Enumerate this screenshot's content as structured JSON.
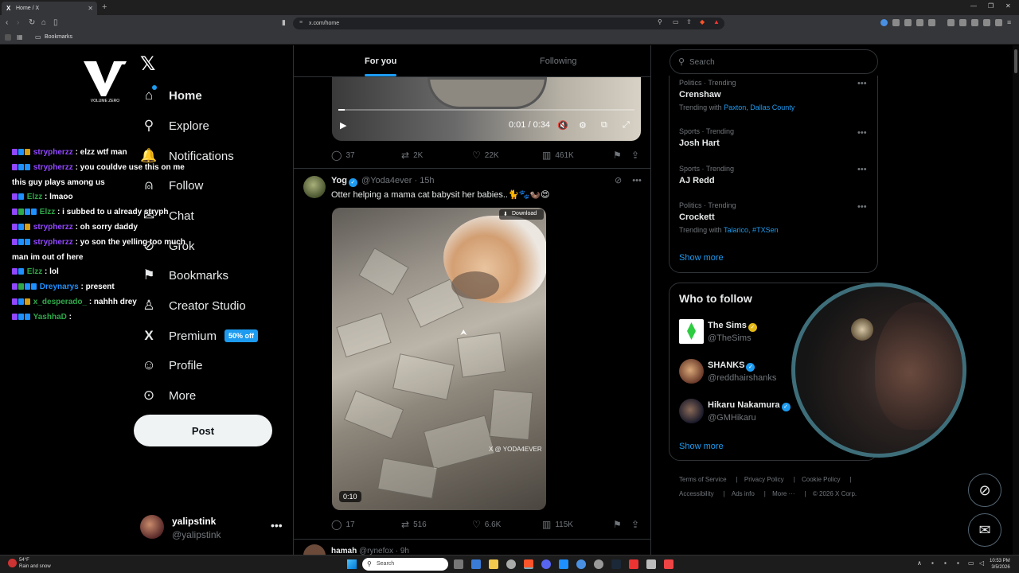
{
  "browser": {
    "tab_title": "Home / X",
    "url": "x.com/home",
    "bookmarks_folder": "Bookmarks",
    "new_tab_symbol": "+"
  },
  "sidebar": {
    "brand_logo_text": "VOLUME ZERO",
    "items": [
      {
        "label": "Home",
        "icon": "home-icon",
        "glyph": "⌂",
        "active": true
      },
      {
        "label": "Explore",
        "icon": "search-icon",
        "glyph": "⚲"
      },
      {
        "label": "Notifications",
        "icon": "bell-icon",
        "glyph": "🔔"
      },
      {
        "label": "Follow",
        "icon": "follow-icon",
        "glyph": "⍝"
      },
      {
        "label": "Chat",
        "icon": "chat-icon",
        "glyph": "✉"
      },
      {
        "label": "Grok",
        "icon": "grok-icon",
        "glyph": "⊘"
      },
      {
        "label": "Bookmarks",
        "icon": "bookmark-icon",
        "glyph": "⚑"
      },
      {
        "label": "Creator Studio",
        "icon": "creator-studio-icon",
        "glyph": "♙"
      },
      {
        "label": "Premium",
        "icon": "x-premium-icon",
        "glyph": "X",
        "badge": "50% off"
      },
      {
        "label": "Profile",
        "icon": "profile-icon",
        "glyph": "☺"
      },
      {
        "label": "More",
        "icon": "more-icon",
        "glyph": "⊙"
      }
    ],
    "post_label": "Post",
    "account": {
      "name": "yalipstink",
      "handle": "@yalipstink"
    }
  },
  "chat": [
    {
      "user": "strypherzz",
      "color": "#9147ff",
      "msg": ": elzz wtf man"
    },
    {
      "user": "strypherzz",
      "color": "#9147ff",
      "msg": ": you couldve use this on me this guy plays among us"
    },
    {
      "user": "Elzz",
      "color": "#2fa84a",
      "msg": ": lmaoo"
    },
    {
      "user": "Elzz",
      "color": "#2fa84a",
      "msg": ": i subbed to u already stryph"
    },
    {
      "user": "strypherzz",
      "color": "#9147ff",
      "msg": ": oh sorry daddy"
    },
    {
      "user": "strypherzz",
      "color": "#9147ff",
      "msg": ": yo son the yelling too much man im out of here"
    },
    {
      "user": "Elzz",
      "color": "#2fa84a",
      "msg": ": lol"
    },
    {
      "user": "Dreynarys",
      "color": "#1e90ff",
      "msg": ": present"
    },
    {
      "user": "x_desperado_",
      "color": "#2fa84a",
      "msg": ": nahhh drey"
    },
    {
      "user": "YashhaD",
      "color": "#2fa84a",
      "msg": ":"
    }
  ],
  "feed": {
    "tabs": [
      "For you",
      "Following"
    ],
    "tweet1": {
      "video_time": "0:01 / 0:34",
      "replies": "37",
      "reposts": "2K",
      "likes": "22K",
      "views": "461K"
    },
    "tweet2": {
      "name": "Yog",
      "handle": "@Yoda4ever",
      "time": "· 15h",
      "text": "Otter helping a mama cat babysit her babies..🐈🐾🦦😍",
      "download_label": "Download",
      "watermark": "X @ YODA4EVER",
      "duration": "0:10",
      "replies": "17",
      "reposts": "516",
      "likes": "6.6K",
      "views": "115K"
    },
    "tweet3": {
      "name": "hamah",
      "handle": "@rynefox",
      "time": "· 9h"
    }
  },
  "right": {
    "search_placeholder": "Search",
    "trends": [
      {
        "context": "Politics · Trending",
        "title": "Crenshaw",
        "with_prefix": "Trending with",
        "with": "Paxton, Dallas County"
      },
      {
        "context": "Sports · Trending",
        "title": "Josh Hart"
      },
      {
        "context": "Sports · Trending",
        "title": "AJ Redd"
      },
      {
        "context": "Politics · Trending",
        "title": "Crockett",
        "with_prefix": "Trending with",
        "with": "Talarico, #TXSen"
      }
    ],
    "show_more": "Show more",
    "who_to_follow": "Who to follow",
    "suggestions": [
      {
        "name": "The Sims",
        "handle": "@TheSims",
        "verified": "gold"
      },
      {
        "name": "SHANKS",
        "handle": "@reddhairshanks",
        "verified": "blue"
      },
      {
        "name": "Hikaru Nakamura",
        "handle": "@GMHikaru",
        "verified": "blue"
      }
    ],
    "show_more_2": "Show more",
    "footer_row1": [
      "Terms of Service",
      "Privacy Policy",
      "Cookie Policy"
    ],
    "footer_row2": [
      "Accessibility",
      "Ads info",
      "More ···",
      "© 2026 X Corp."
    ]
  },
  "taskbar": {
    "weather_temp": "54°F",
    "weather_desc": "Rain and snow",
    "search_placeholder": "Search",
    "time": "10:53 PM",
    "date": "3/5/2026"
  },
  "colors": {
    "accent": "#1d9bf0",
    "background": "#000000",
    "border": "#2f3336",
    "muted_text": "#71767b",
    "webcam_ring": "#3e6e7a"
  }
}
